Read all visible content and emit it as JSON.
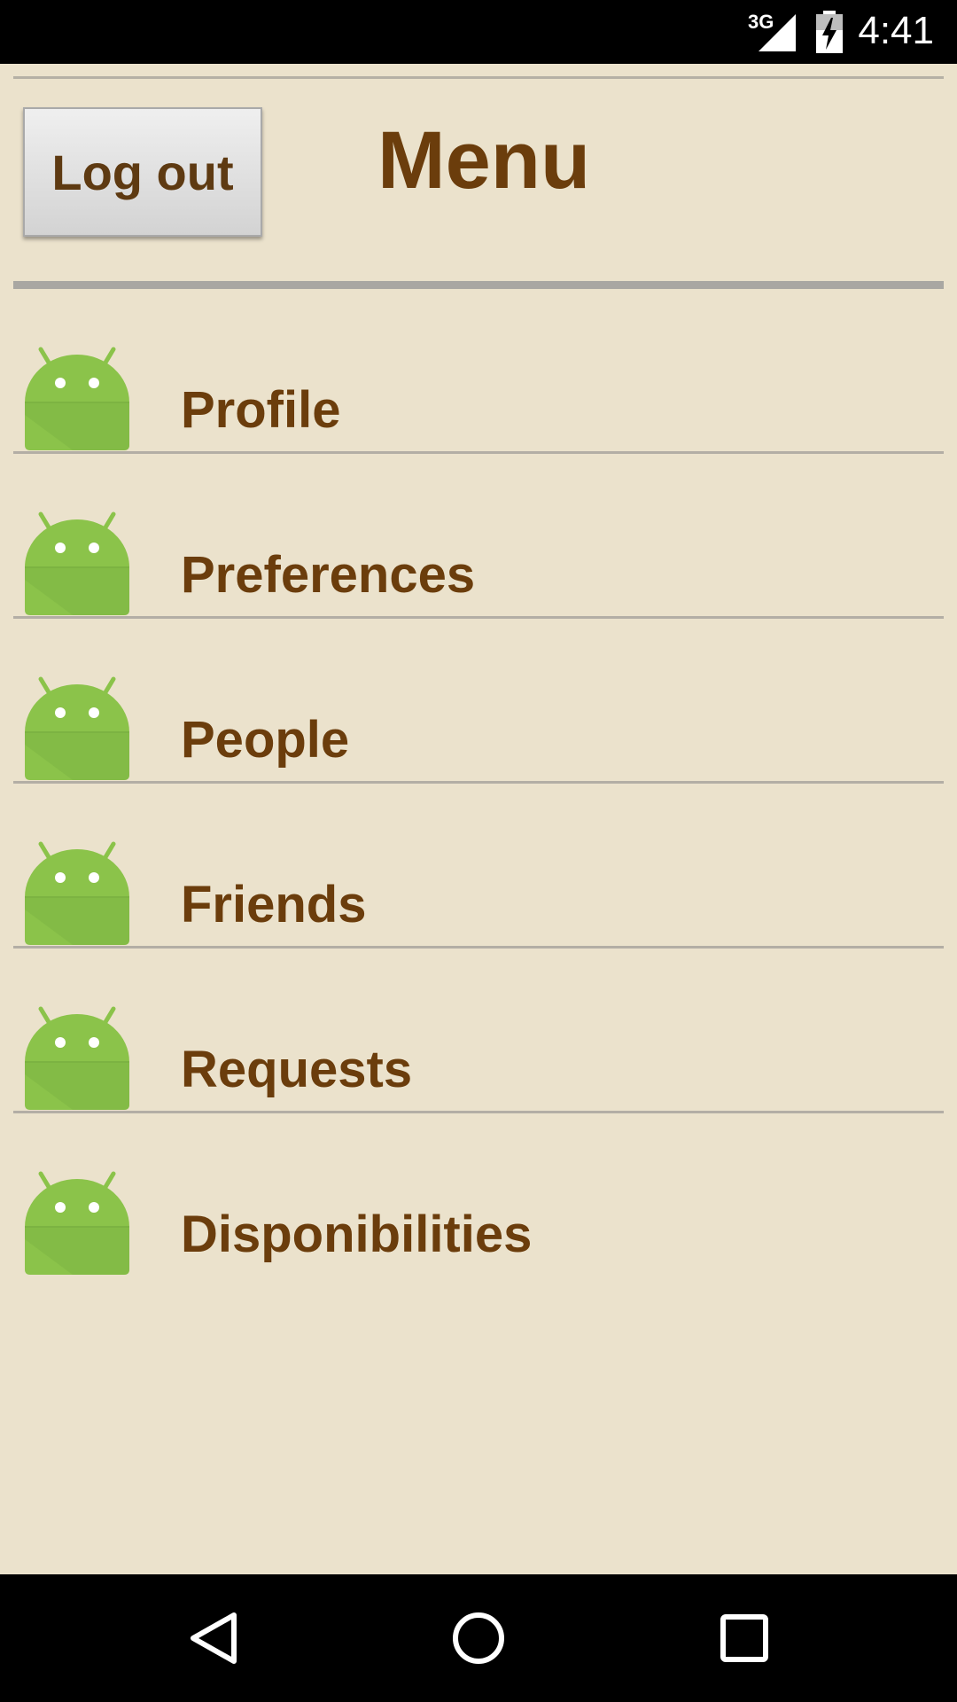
{
  "status_bar": {
    "network_type": "3G",
    "time": "4:41",
    "icons": [
      "signal-icon",
      "battery-charging-icon"
    ]
  },
  "header": {
    "logout_label": "Log out",
    "title": "Menu"
  },
  "menu": {
    "items": [
      {
        "label": "Profile",
        "icon": "android-icon"
      },
      {
        "label": "Preferences",
        "icon": "android-icon"
      },
      {
        "label": "People",
        "icon": "android-icon"
      },
      {
        "label": "Friends",
        "icon": "android-icon"
      },
      {
        "label": "Requests",
        "icon": "android-icon"
      },
      {
        "label": "Disponibilities",
        "icon": "android-icon"
      }
    ]
  },
  "nav_bar": {
    "buttons": [
      "back-icon",
      "home-icon",
      "recents-icon"
    ]
  },
  "colors": {
    "background": "#ebe2cc",
    "text": "#6b3d0c",
    "android_green": "#8bc34a"
  }
}
